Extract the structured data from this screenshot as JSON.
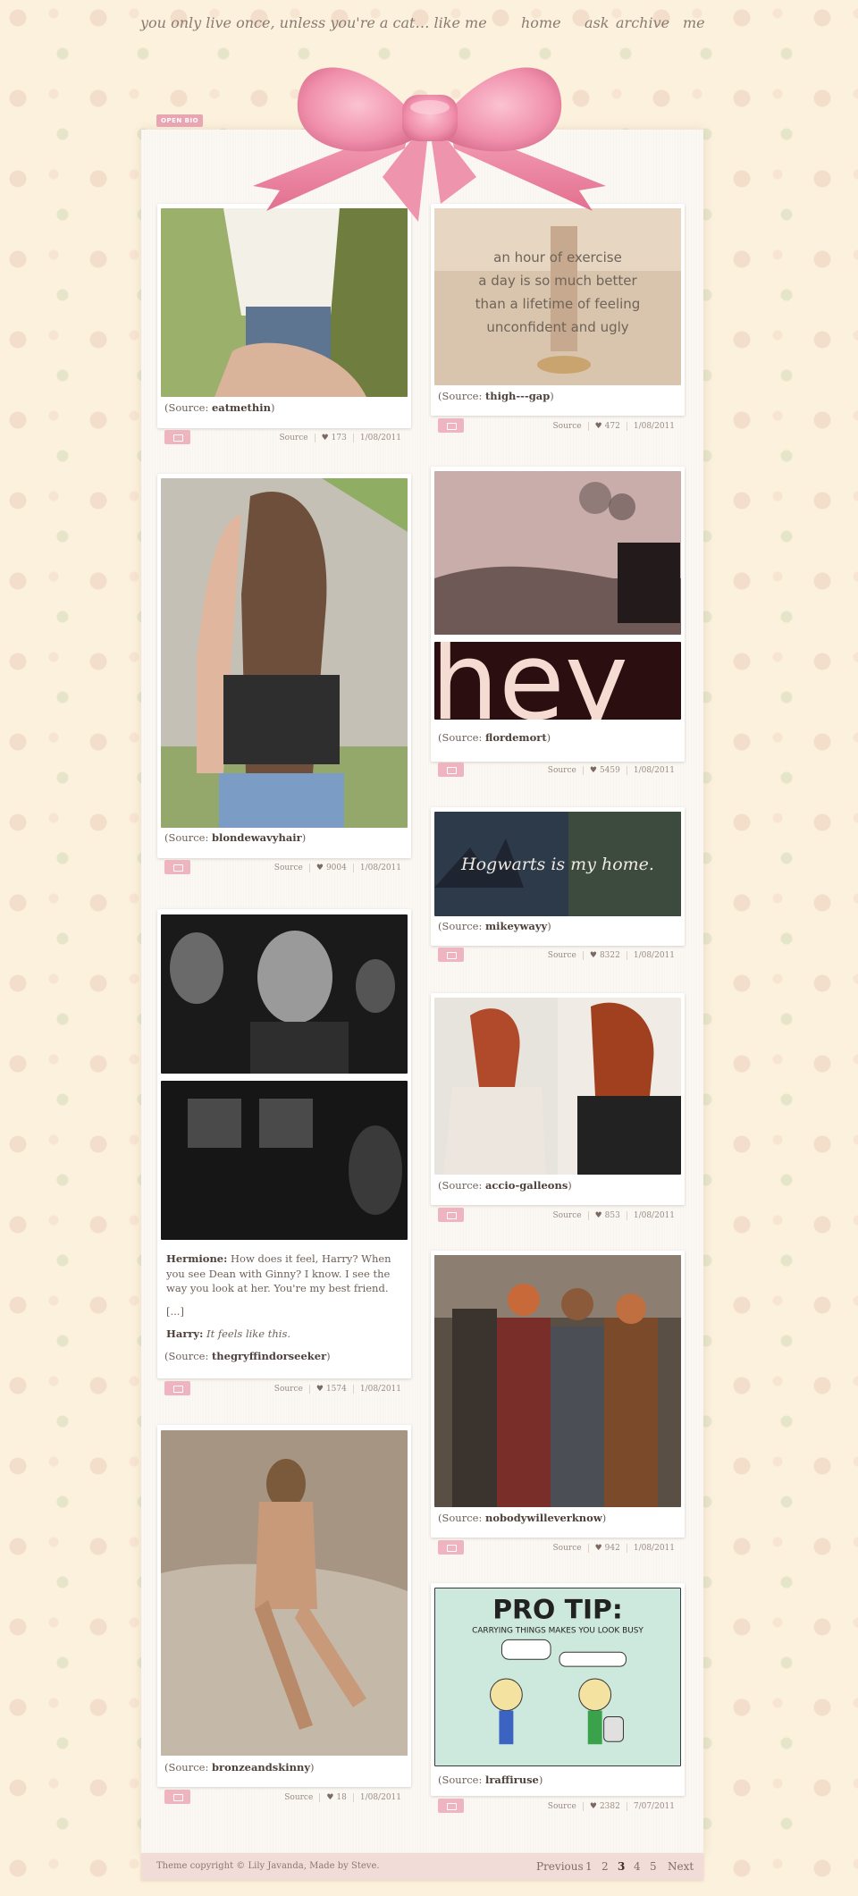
{
  "header": {
    "tagline": "you only live once, unless you're a cat… like me",
    "nav": [
      "home",
      "ask",
      "archive",
      "me"
    ]
  },
  "open_bio": "OPEN BIO",
  "colors": {
    "accent_pink": "#eeb5c0",
    "bow": "#f18aa9",
    "background": "#fbf1dc"
  },
  "posts": [
    {
      "source_prefix": "(Source: ",
      "source_name": "eatmethin",
      "source_suffix": ")",
      "link": "Source",
      "notes": "173",
      "date": "1/08/2011"
    },
    {
      "source_prefix": "(Source: ",
      "source_name": "thigh---gap",
      "source_suffix": ")",
      "link": "Source",
      "notes": "472",
      "date": "1/08/2011",
      "image_text": [
        "an hour of exercise",
        "a day is so much better",
        "than a lifetime of feeling",
        "unconfident and ugly"
      ]
    },
    {
      "source_prefix": "(Source: ",
      "source_name": "blondewavyhair",
      "source_suffix": ")",
      "link": "Source",
      "notes": "9004",
      "date": "1/08/2011"
    },
    {
      "source_prefix": "(Source: ",
      "source_name": "flordemort",
      "source_suffix": ")",
      "link": "Source",
      "notes": "5459",
      "date": "1/08/2011",
      "image_text": "hey"
    },
    {
      "source_prefix": "(Source: ",
      "source_name": "mikeywayy",
      "source_suffix": ")",
      "link": "Source",
      "notes": "8322",
      "date": "1/08/2011",
      "image_text": "Hogwarts is my home."
    },
    {
      "source_prefix": "(Source: ",
      "source_name": "thegryffindorseeker",
      "source_suffix": ")",
      "link": "Source",
      "notes": "1574",
      "date": "1/08/2011",
      "speaker1": "Hermione:",
      "line1": " How does it feel, Harry? When you see Dean with Ginny? I know. I see the way you look at her. You're my best friend.",
      "ellipsis": "[...]",
      "speaker2": "Harry:",
      "line2": " It feels like this."
    },
    {
      "source_prefix": "(Source: ",
      "source_name": "accio-galleons",
      "source_suffix": ")",
      "link": "Source",
      "notes": "853",
      "date": "1/08/2011"
    },
    {
      "source_prefix": "(Source: ",
      "source_name": "nobodywilleverknow",
      "source_suffix": ")",
      "link": "Source",
      "notes": "942",
      "date": "1/08/2011"
    },
    {
      "source_prefix": "(Source: ",
      "source_name": "bronzeandskinny",
      "source_suffix": ")",
      "link": "Source",
      "notes": "18",
      "date": "1/08/2011"
    },
    {
      "source_prefix": "(Source: ",
      "source_name": "lraffiruse",
      "source_suffix": ")",
      "link": "Source",
      "notes": "2382",
      "date": "7/07/2011",
      "image_text": [
        "PRO TIP:",
        "CARRYING THINGS MAKES YOU LOOK BUSY"
      ]
    }
  ],
  "footer": {
    "copyright": "Theme copyright © Lily Javanda, Made by Steve.",
    "pagination": [
      "Previous",
      "1",
      "2",
      "3",
      "4",
      "5",
      "Next"
    ]
  }
}
